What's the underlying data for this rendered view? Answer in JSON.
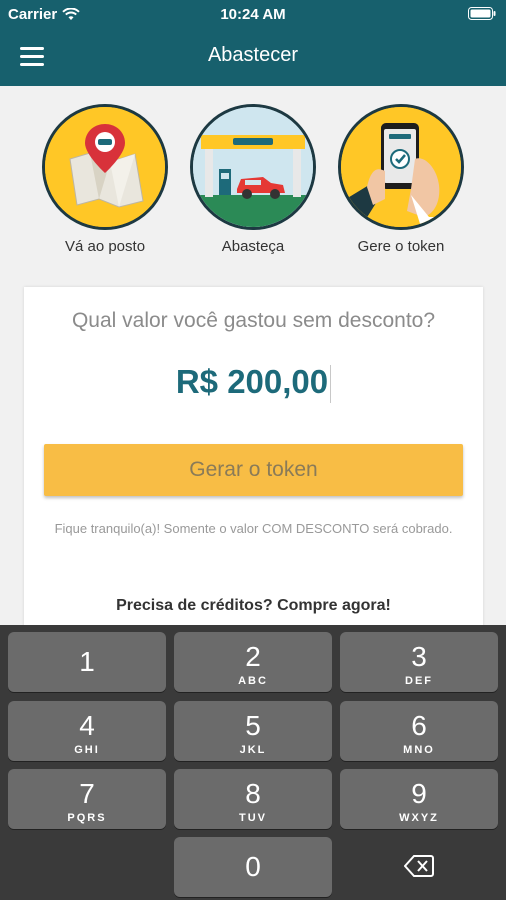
{
  "status": {
    "carrier": "Carrier",
    "time": "10:24 AM"
  },
  "nav": {
    "title": "Abastecer"
  },
  "steps": [
    {
      "label": "Vá ao posto",
      "icon": "map-pin-icon"
    },
    {
      "label": "Abasteça",
      "icon": "gas-station-icon"
    },
    {
      "label": "Gere o token",
      "icon": "phone-token-icon"
    }
  ],
  "card": {
    "question": "Qual valor você gastou sem desconto?",
    "amount": "R$ 200,00",
    "button_label": "Gerar o token",
    "note": "Fique tranquilo(a)! Somente o valor COM DESCONTO será cobrado.",
    "buy_text": "Precisa de créditos? Compre agora!"
  },
  "keypad": {
    "keys": [
      {
        "digit": "1",
        "letters": ""
      },
      {
        "digit": "2",
        "letters": "ABC"
      },
      {
        "digit": "3",
        "letters": "DEF"
      },
      {
        "digit": "4",
        "letters": "GHI"
      },
      {
        "digit": "5",
        "letters": "JKL"
      },
      {
        "digit": "6",
        "letters": "MNO"
      },
      {
        "digit": "7",
        "letters": "PQRS"
      },
      {
        "digit": "8",
        "letters": "TUV"
      },
      {
        "digit": "9",
        "letters": "WXYZ"
      },
      {
        "digit": "0",
        "letters": ""
      }
    ]
  },
  "colors": {
    "accent": "#17606d",
    "button": "#f8bd45",
    "amount": "#1d6a7a"
  }
}
